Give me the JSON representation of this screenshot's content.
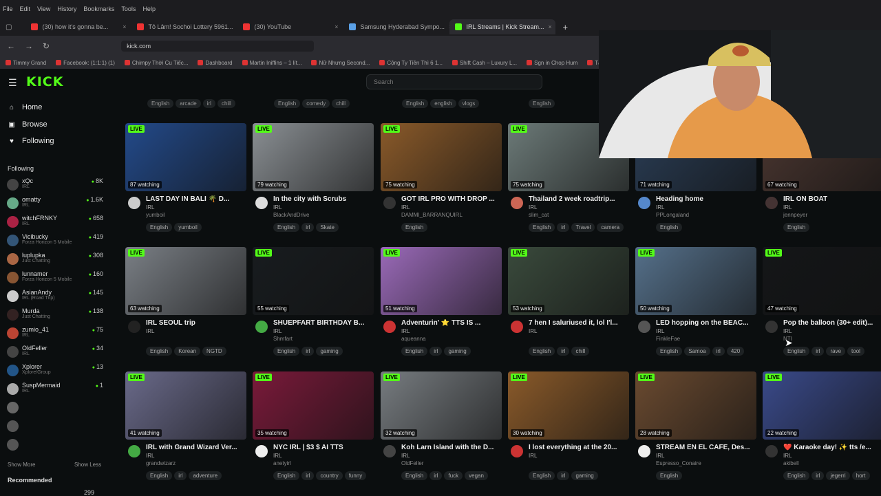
{
  "browser": {
    "menu": [
      "File",
      "Edit",
      "View",
      "History",
      "Bookmarks",
      "Tools",
      "Help"
    ],
    "tabs": [
      {
        "label": "(30) how it's gonna be...",
        "color": "#e33",
        "active": false
      },
      {
        "label": "Tô Lâm! Sochoi Lottery 5961...",
        "color": "#e33",
        "active": false
      },
      {
        "label": "(30) YouTube",
        "color": "#e33",
        "active": false
      },
      {
        "label": "Samsung Hyderabad Sympo...",
        "color": "#5aa0e6",
        "active": false
      },
      {
        "label": "IRL Streams | Kick Stream...",
        "color": "#53fc18",
        "active": true
      }
    ],
    "url": "kick.com",
    "bookmarks": [
      "Timmy Grand",
      "Facebook: (1:1:1) (1)",
      "Chimpy Thời Cu Tiếc...",
      "Dashboard",
      "Martin Iniffins – 1 lít...",
      "Nữ Nhưng Second...",
      "Cộng Ty Tiền Thì 6 1...",
      "Shift Cash – Luxury L...",
      "Sgn in Chop Hum",
      "Tài Hòm Mạnh",
      "Gmail Sub"
    ]
  },
  "sidebar": {
    "logo": "KICK",
    "nav": [
      {
        "label": "Home",
        "icon": "home-icon",
        "glyph": "⌂"
      },
      {
        "label": "Browse",
        "icon": "browse-icon",
        "glyph": "▣"
      },
      {
        "label": "Following",
        "icon": "heart-icon",
        "glyph": "♥"
      }
    ],
    "following_header": "Following",
    "following": [
      {
        "name": "xQc",
        "sub": "IRL",
        "count": "8K",
        "color": "#444"
      },
      {
        "name": "omatty",
        "sub": "IRL",
        "count": "1.6K",
        "color": "#6a8"
      },
      {
        "name": "witchFRNKY",
        "sub": "IRL",
        "count": "658",
        "color": "#a24"
      },
      {
        "name": "Vicibucky",
        "sub": "Forza Horizon 5 Mobile",
        "count": "419",
        "color": "#357"
      },
      {
        "name": "luplupka",
        "sub": "Just Chatting",
        "count": "308",
        "color": "#a64"
      },
      {
        "name": "lunnamer",
        "sub": "Forza Horizon 5 Mobile",
        "count": "160",
        "color": "#853"
      },
      {
        "name": "AsianAndy",
        "sub": "IRL (Road Trip)",
        "count": "145",
        "color": "#ccc"
      },
      {
        "name": "Murda",
        "sub": "Just Chatting",
        "count": "138",
        "color": "#322"
      },
      {
        "name": "zumio_41",
        "sub": "IRL",
        "count": "75",
        "color": "#b43"
      },
      {
        "name": "OldFeller",
        "sub": "IRL",
        "count": "34",
        "color": "#444"
      },
      {
        "name": "Xplorer",
        "sub": "Xplore/Group",
        "count": "13",
        "color": "#258"
      },
      {
        "name": "SuspMermaid",
        "sub": "IRL",
        "count": "1",
        "color": "#aaa"
      },
      {
        "name": "",
        "sub": "",
        "count": "",
        "color": "#666"
      },
      {
        "name": "",
        "sub": "",
        "count": "",
        "color": "#555"
      },
      {
        "name": "",
        "sub": "",
        "count": "",
        "color": "#555"
      }
    ],
    "show_more": "Show More",
    "show_less": "Show Less",
    "recommended": "Recommended",
    "rec_count": "299"
  },
  "search": {
    "placeholder": "Search"
  },
  "top_tags": [
    [
      "English",
      "arcade",
      "irl",
      "chill"
    ],
    [
      "English",
      "comedy",
      "chill"
    ],
    [
      "English",
      "english",
      "vlogs"
    ],
    [
      "English"
    ],
    [
      "English"
    ]
  ],
  "streams": [
    {
      "title": "LAST DAY IN BALI 🌴 D...",
      "cat": "IRL",
      "user": "yumboil",
      "viewers": "87 watching",
      "tags": [
        "English",
        "yumboil"
      ],
      "bg": "#234a8a",
      "av": "#ccc"
    },
    {
      "title": "In the city with Scrubs",
      "cat": "IRL",
      "user": "BlackAndDrive",
      "viewers": "79 watching",
      "tags": [
        "English",
        "irl",
        "Skate"
      ],
      "bg": "#8a8f93",
      "av": "#ddd"
    },
    {
      "title": "GOT IRL PRO WITH DROP ...",
      "cat": "IRL",
      "user": "DAMMI_BARRANQUIRL",
      "viewers": "75 watching",
      "tags": [
        "English"
      ],
      "bg": "#8a5a2a",
      "av": "#333"
    },
    {
      "title": "Thailand 2 week roadtrip...",
      "cat": "IRL",
      "user": "slim_cat",
      "viewers": "75 watching",
      "tags": [
        "English",
        "irl",
        "Travel",
        "camera"
      ],
      "bg": "#6c7a78",
      "av": "#c65"
    },
    {
      "title": "Heading home",
      "cat": "IRL",
      "user": "PPLongaland",
      "viewers": "71 watching",
      "tags": [
        "English"
      ],
      "bg": "#2a3d55",
      "av": "#58c"
    },
    {
      "title": "IRL ON BOAT",
      "cat": "IRL",
      "user": "jennpeyer",
      "viewers": "67 watching",
      "tags": [
        "English"
      ],
      "bg": "#4a3630",
      "av": "#433"
    },
    {
      "title": "IRL SEOUL trip",
      "cat": "IRL",
      "user": "",
      "viewers": "63 watching",
      "tags": [
        "English",
        "Korean",
        "NGTD"
      ],
      "bg": "#7a7f85",
      "av": "#222"
    },
    {
      "title": "SHUEPFART BIRTHDAY B...",
      "cat": "IRL",
      "user": "Shmfart",
      "viewers": "55 watching",
      "tags": [
        "English",
        "irl",
        "gaming"
      ],
      "bg": "#181c1f",
      "av": "#4a4"
    },
    {
      "title": "Adventurin' ⭐ TTS IS ...",
      "cat": "IRL",
      "user": "aqueanna",
      "viewers": "51 watching",
      "tags": [
        "English",
        "irl",
        "gaming"
      ],
      "bg": "#9a6ab8",
      "av": "#c33"
    },
    {
      "title": "7 hen I saluriused it, lol I'l...",
      "cat": "IRL",
      "user": "",
      "viewers": "53 watching",
      "tags": [
        "English",
        "irl",
        "chill"
      ],
      "bg": "#3a4a3c",
      "av": "#c33"
    },
    {
      "title": "LED hopping on the BEAC...",
      "cat": "IRL",
      "user": "FinkleFae",
      "viewers": "50 watching",
      "tags": [
        "English",
        "Samoa",
        "irl",
        "420"
      ],
      "bg": "#55708a",
      "av": "#555"
    },
    {
      "title": "Pop the balloon (30+ edit)...",
      "cat": "IRL",
      "user": "NTI",
      "viewers": "47 watching",
      "tags": [
        "English",
        "irl",
        "rave",
        "tool"
      ],
      "bg": "#141618",
      "av": "#333"
    },
    {
      "title": "IRL with Grand Wizard Ver...",
      "cat": "IRL",
      "user": "grandwizarz",
      "viewers": "41 watching",
      "tags": [
        "English",
        "irl",
        "adventure"
      ],
      "bg": "#6a6a8a",
      "av": "#4a4"
    },
    {
      "title": "NYC IRL | $3 $ AI TTS",
      "cat": "IRL",
      "user": "anetyirl",
      "viewers": "35 watching",
      "tags": [
        "English",
        "irl",
        "country",
        "funny"
      ],
      "bg": "#7a1a3a",
      "av": "#eee"
    },
    {
      "title": "Koh Larn Island with the D...",
      "cat": "IRL",
      "user": "OldFeller",
      "viewers": "32 watching",
      "tags": [
        "English",
        "irl",
        "fuck",
        "vegan"
      ],
      "bg": "#777c80",
      "av": "#444"
    },
    {
      "title": "I lost everything at the 20...",
      "cat": "IRL",
      "user": "",
      "viewers": "30 watching",
      "tags": [
        "English",
        "irl",
        "gaming"
      ],
      "bg": "#8a5a2a",
      "av": "#c33"
    },
    {
      "title": "STREAM EN EL CAFE, Des...",
      "cat": "IRL",
      "user": "Espresso_Conaire",
      "viewers": "28 watching",
      "tags": [
        "English"
      ],
      "bg": "#6a4a30",
      "av": "#eee"
    },
    {
      "title": "❤️ Karaoke day! ✨ tts /e...",
      "cat": "IRL",
      "user": "akibell",
      "viewers": "22 watching",
      "tags": [
        "English",
        "irl",
        "jegerri",
        "hort"
      ],
      "bg": "#3a4a8a",
      "av": "#333"
    }
  ],
  "live_badge": "LIVE"
}
